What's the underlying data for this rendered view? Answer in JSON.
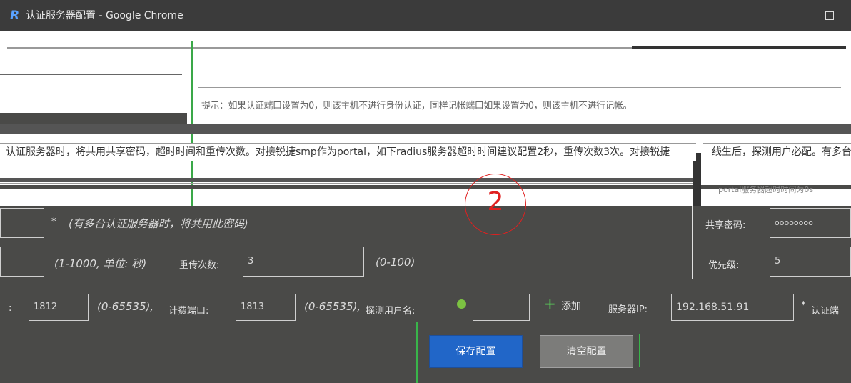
{
  "window": {
    "logo": "R",
    "title": "认证服务器配置 - Google Chrome"
  },
  "notice": {
    "tip": "提示：如果认证端口设置为0，则该主机不进行身份认证，同样记帐端口如果设置为0，则该主机不进行记帐。",
    "intro": "认证服务器时，将共用共享密码，超时时间和重传次数。对接锐捷smp作为portal，如下radius服务器超时时间建议配置2秒，重传次数3次。对接锐捷",
    "intro_right": "线生后，探测用户必配。有多台",
    "timeout_hint": "portal服务器超时时间为0s"
  },
  "marker": {
    "number": "2"
  },
  "form": {
    "shared_secret_hint": "(有多台认证服务器时，将共用此密码)",
    "shared_secret_label": "共享密码:",
    "shared_secret_value": "oooooooo",
    "timeout_hint": "(1-1000, 单位: 秒)",
    "retrans_label": "重传次数:",
    "retrans_value": "3",
    "retrans_range": "(0-100)",
    "priority_label": "优先级:",
    "priority_value": "5",
    "auth_port_value": "1812",
    "auth_port_range": "(0-65535),",
    "acct_port_label": "计费端口:",
    "acct_port_value": "1813",
    "acct_port_range": "(0-65535),",
    "probe_label": "探测用户名:",
    "add_label": "添加",
    "server_ip_label": "服务器IP:",
    "server_ip_value": "192.168.51.91",
    "auth_suffix": "认证端"
  },
  "buttons": {
    "save": "保存配置",
    "clear": "清空配置"
  }
}
